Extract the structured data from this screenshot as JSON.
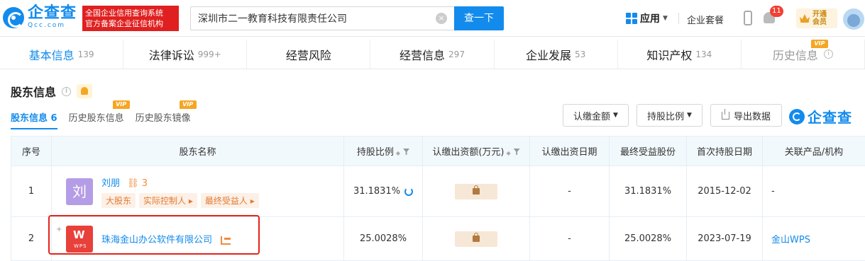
{
  "header": {
    "logo_cn": "企查查",
    "logo_en": "Qcc.com",
    "slogan_line1": "全国企业信用查询系统",
    "slogan_line2": "官方备案企业征信机构",
    "search_value": "深圳市二一教育科技有限责任公司",
    "search_button": "查一下",
    "app_label": "应用",
    "suite_label": "企业套餐",
    "notification_count": "11",
    "vip_open_line1": "开通",
    "vip_open_line2": "会员"
  },
  "tabs": [
    {
      "label": "基本信息",
      "count": "139"
    },
    {
      "label": "法律诉讼",
      "count": "999+"
    },
    {
      "label": "经营风险",
      "count": ""
    },
    {
      "label": "经营信息",
      "count": "297"
    },
    {
      "label": "企业发展",
      "count": "53"
    },
    {
      "label": "知识产权",
      "count": "134"
    },
    {
      "label": "历史信息",
      "count": ""
    }
  ],
  "vip_tag": "VIP",
  "section": {
    "title": "股东信息",
    "info_glyph": "i"
  },
  "subtabs": [
    {
      "label": "股东信息",
      "count": "6"
    },
    {
      "label": "历史股东信息"
    },
    {
      "label": "历史股东镜像"
    }
  ],
  "toolbar": {
    "subscribed_amount": "认缴金额",
    "share_ratio": "持股比例",
    "export": "导出数据",
    "watermark": "企查查"
  },
  "table": {
    "headers": [
      "序号",
      "股东名称",
      "持股比例",
      "认缴出资额(万元)",
      "认缴出资日期",
      "最终受益股份",
      "首次持股日期",
      "关联产品/机构"
    ],
    "rows": [
      {
        "index": "1",
        "avatar_char": "刘",
        "name": "刘朋",
        "link_count": "3",
        "tags": [
          "大股东",
          "实际控制人",
          "最终受益人"
        ],
        "ratio": "31.1831%",
        "subscribed_date": "-",
        "beneficial": "31.1831%",
        "first_date": "2015-12-02",
        "product": "-"
      },
      {
        "index": "2",
        "avatar_logo_text": "WPS",
        "avatar_logo_glyph": "W",
        "expand_glyph": "+",
        "name": "珠海金山办公软件有限公司",
        "ratio": "25.0028%",
        "subscribed_date": "-",
        "beneficial": "25.0028%",
        "first_date": "2023-07-19",
        "product": "金山WPS"
      }
    ]
  },
  "colors": {
    "accent": "#128bed",
    "slogan_bg": "#e02020",
    "highlight": "#e3231a",
    "tag_text": "#e07b32"
  }
}
